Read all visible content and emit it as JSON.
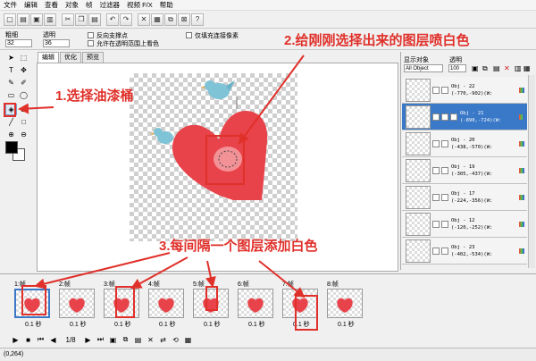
{
  "menu": [
    "文件",
    "编辑",
    "查看",
    "对象",
    "帧",
    "过滤器",
    "视频 F/X",
    "帮助"
  ],
  "toolbar_icons": [
    "new-icon",
    "open-icon",
    "save-icon",
    "save-as-icon",
    "cut-icon",
    "copy-icon",
    "paste-icon",
    "undo-icon",
    "redo-icon",
    "delete-icon",
    "add-frame-icon",
    "duplicate-icon",
    "delete-frame-icon",
    "help-icon"
  ],
  "options": {
    "thickness_label": "粗细",
    "thickness_value": "32",
    "opacity_label": "透明",
    "opacity_value": "36",
    "antialias_label": "反向支撑点",
    "transparent_view_label": "允许在透明范围上看色",
    "fill_transparent_label": "仅填充连接像素"
  },
  "tabs": [
    "编辑",
    "优化",
    "预览"
  ],
  "right_panel": {
    "show_objects_label": "显示对象",
    "opacity_label": "透明",
    "show_objects_value": "All Object",
    "opacity_value": "100",
    "layers": [
      {
        "name": "Obj - 22",
        "coords": "(-770,-902)(W:"
      },
      {
        "name": "Obj - 21",
        "coords": "(-890,-724)(W:",
        "selected": true
      },
      {
        "name": "Obj - 20",
        "coords": "(-438,-570)(W:"
      },
      {
        "name": "Obj - 19",
        "coords": "(-305,-437)(W:"
      },
      {
        "name": "Obj - 17",
        "coords": "(-224,-356)(W:"
      },
      {
        "name": "Obj - 12",
        "coords": "(-120,-252)(W:"
      },
      {
        "name": "Obj - 23",
        "coords": "(-402,-534)(W:"
      }
    ]
  },
  "annotations": {
    "step1": "1.选择油漆桶",
    "step2": "2.给刚刚选择出来的图层喷白色",
    "step3": "3.每间隔一个图层添加白色"
  },
  "frames": [
    {
      "label": "1:帧",
      "delay": "0.1 秒"
    },
    {
      "label": "2:帧",
      "delay": "0.1 秒"
    },
    {
      "label": "3:帧",
      "delay": "0.1 秒"
    },
    {
      "label": "4:帧",
      "delay": "0.1 秒"
    },
    {
      "label": "5:帧",
      "delay": "0.1 秒"
    },
    {
      "label": "6:帧",
      "delay": "0.1 秒"
    },
    {
      "label": "7:帧",
      "delay": "0.1 秒"
    },
    {
      "label": "8:帧",
      "delay": "0.1 秒"
    }
  ],
  "playback": {
    "frame_counter": "1/8"
  },
  "status": {
    "coords": "(0,264)"
  },
  "colors": {
    "heart": "#e8434a",
    "bird": "#7fc3d6",
    "annotation": "#e0302a",
    "selection": "#3a78c8",
    "foreground": "#000000",
    "background": "#ffffff"
  }
}
